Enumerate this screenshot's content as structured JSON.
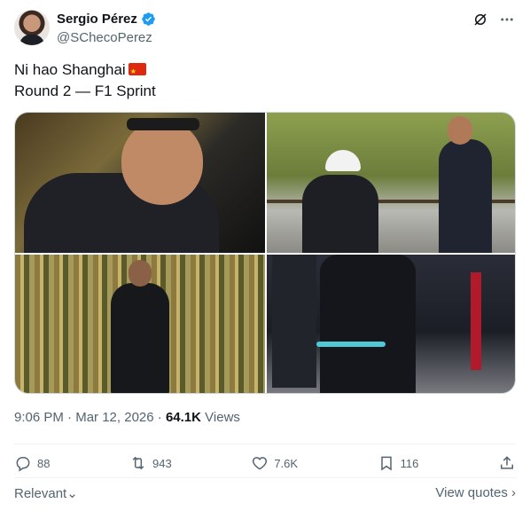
{
  "author": {
    "display_name": "Sergio Pérez",
    "handle": "@SChecoPerez"
  },
  "icons": {
    "verified": "verified-badge-icon",
    "grok": "grok-icon",
    "more": "more-icon",
    "reply": "reply-icon",
    "retweet": "retweet-icon",
    "like": "like-icon",
    "bookmark": "bookmark-icon",
    "share": "share-icon"
  },
  "colors": {
    "accent": "#1d9bf0",
    "muted": "#536471"
  },
  "tweet": {
    "line1": "Ni hao Shanghai",
    "line2": "Round 2 — F1 Sprint",
    "time": "9:06 PM",
    "separator1": "·",
    "date": "Mar 12, 2026",
    "separator2": "·",
    "views_count": "64.1K",
    "views_label": "Views"
  },
  "stats": {
    "replies": "88",
    "retweets": "943",
    "likes": "7.6K",
    "bookmarks": "116"
  },
  "footer": {
    "relevant_label": "Relevant",
    "view_quotes_label": "View quotes"
  }
}
